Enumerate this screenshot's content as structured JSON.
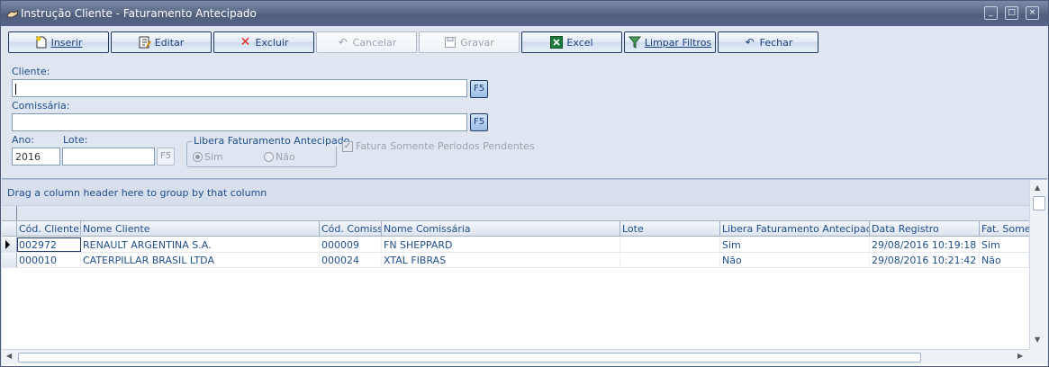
{
  "window": {
    "title": "Instrução Cliente - Faturamento Antecipado",
    "controls": [
      "_",
      "□",
      "×"
    ]
  },
  "toolbar": {
    "buttons": [
      {
        "label": "Inserir",
        "icon": "new-document-icon",
        "enabled": true
      },
      {
        "label": "Editar",
        "icon": "edit-document-icon",
        "enabled": true
      },
      {
        "label": "Excluir",
        "icon": "red-x-icon",
        "enabled": true
      },
      {
        "label": "Cancelar",
        "icon": "undo-icon",
        "enabled": false
      },
      {
        "label": "Gravar",
        "icon": "save-disk-icon",
        "enabled": false
      },
      {
        "label": "Excel",
        "icon": "excel-icon",
        "enabled": true
      },
      {
        "label": "Limpar Filtros",
        "icon": "clear-filter-icon",
        "enabled": true
      },
      {
        "label": "Fechar",
        "icon": "undo-icon",
        "enabled": true
      }
    ]
  },
  "form": {
    "cliente_label": "Cliente:",
    "cliente_value": "",
    "comissaria_label": "Comissária:",
    "comissaria_value": "",
    "f5_label": "F5",
    "ano_label": "Ano:",
    "ano_value": "2016",
    "lote_label": "Lote:",
    "lote_value": "",
    "libera_group_title": "Libera Faturamento Antecipado",
    "radio_sim": "Sim",
    "radio_nao": "Não",
    "radio_selected": "Sim",
    "fatura_checkbox_label": "Fatura Somente Períodos Pendentes",
    "fatura_checked": true
  },
  "grid": {
    "group_hint": "Drag a column header here to group by that column",
    "columns": [
      "Cód. Cliente",
      "Nome Cliente",
      "Cód. Comiss.",
      "Nome Comissária",
      "Lote",
      "Libera Faturamento Antecipado",
      "Data Registro",
      "Fat. Somen"
    ],
    "rows": [
      [
        "002972",
        "RENAULT ARGENTINA S.A.",
        "000009",
        "FN SHEPPARD",
        "",
        "Sim",
        "29/08/2016 10:19:18",
        "Sim"
      ],
      [
        "000010",
        "CATERPILLAR BRASIL LTDA",
        "000024",
        "XTAL FIBRAS",
        "",
        "Não",
        "29/08/2016 10:21:42",
        "Não"
      ]
    ]
  },
  "colors": {
    "title_bar": "#5c6b88",
    "form_bg": "#dfe6f0",
    "text_blue": "#1f4e8c"
  }
}
